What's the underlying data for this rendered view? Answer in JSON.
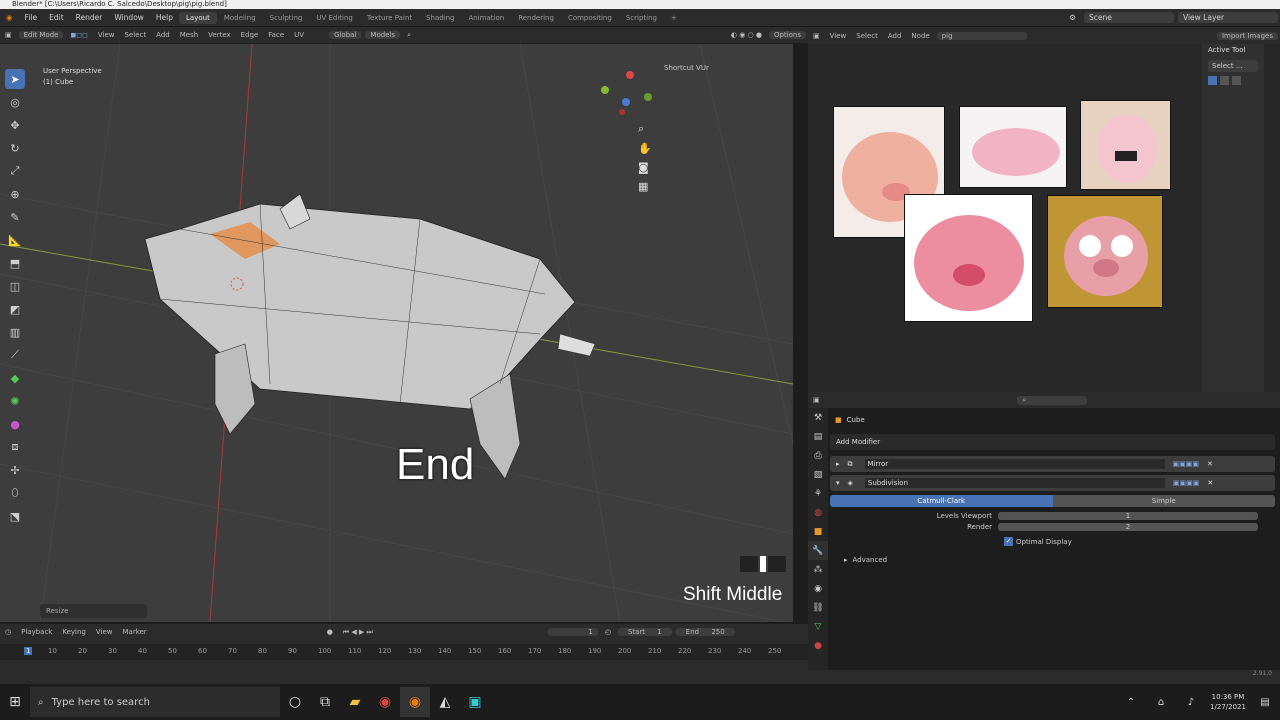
{
  "window_title": "Blender* [C:\\Users\\Ricardo C. Salcedo\\Desktop\\pig\\pig.blend]",
  "top_menu": [
    "File",
    "Edit",
    "Render",
    "Window",
    "Help"
  ],
  "workspaces": [
    "Layout",
    "Modeling",
    "Sculpting",
    "UV Editing",
    "Texture Paint",
    "Shading",
    "Animation",
    "Rendering",
    "Compositing",
    "Scripting"
  ],
  "scene_label": "Scene",
  "view_layer_label": "View Layer",
  "viewport_header": {
    "mode": "Edit Mode",
    "menus": [
      "View",
      "Select",
      "Add",
      "Mesh",
      "Vertex",
      "Edge",
      "Face",
      "UV"
    ],
    "transform": "Global",
    "models_label": "Models",
    "options": "Options"
  },
  "viewport_info": {
    "perspective": "User Perspective",
    "object": "(1) Cube"
  },
  "shortcut_vur": "Shortcut VUr",
  "overlay_key": "End",
  "overlay_mouse": "Shift Middle",
  "last_op": "Resize",
  "image_editor": {
    "menus": [
      "View",
      "Select",
      "Add",
      "Node"
    ],
    "image_name": "pig",
    "import_button": "Import Images",
    "active_tool": "Active Tool",
    "select_label": "Select ..."
  },
  "properties": {
    "object_name": "Cube",
    "add_modifier": "Add Modifier",
    "modifiers": [
      "Mirror",
      "Subdivision"
    ],
    "subdiv_types": [
      "Catmull-Clark",
      "Simple"
    ],
    "levels_viewport_label": "Levels Viewport",
    "levels_viewport_value": "1",
    "render_label": "Render",
    "render_value": "2",
    "optimal_display": "Optimal Display",
    "advanced": "Advanced"
  },
  "timeline": {
    "menus": [
      "Playback",
      "Keying",
      "View",
      "Marker"
    ],
    "current_frame": "1",
    "start_label": "Start",
    "start_value": "1",
    "end_label": "End",
    "end_value": "250",
    "ticks": [
      "1",
      "10",
      "20",
      "30",
      "40",
      "50",
      "60",
      "70",
      "80",
      "90",
      "100",
      "110",
      "120",
      "130",
      "140",
      "150",
      "160",
      "170",
      "180",
      "190",
      "200",
      "210",
      "220",
      "230",
      "240",
      "250"
    ]
  },
  "version": "2.91.0",
  "taskbar": {
    "search_placeholder": "Type here to search",
    "time": "10:36 PM",
    "date": "1/27/2021"
  },
  "colors": {
    "accent": "#4772b3",
    "viewport_bg": "#3d3d3d",
    "selection": "#e8873a"
  }
}
